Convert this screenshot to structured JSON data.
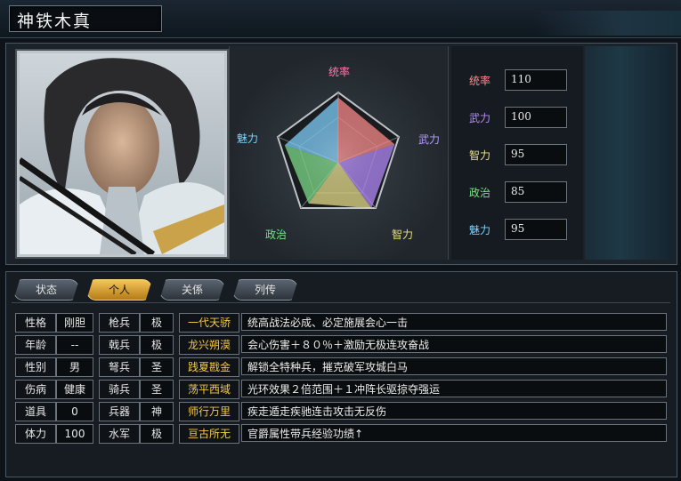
{
  "header": {
    "name": "神铁木真"
  },
  "radar": {
    "labels": {
      "top": "统率",
      "right": "武力",
      "bottom_right": "智力",
      "bottom_left": "政治",
      "left": "魅力"
    },
    "values": [
      110,
      100,
      95,
      85,
      95
    ]
  },
  "stats": [
    {
      "label": "统率",
      "value": "110",
      "color": "#ff8a8a"
    },
    {
      "label": "武力",
      "value": "100",
      "color": "#b58aff"
    },
    {
      "label": "智力",
      "value": "95",
      "color": "#e9e08a"
    },
    {
      "label": "政治",
      "value": "85",
      "color": "#7ee08a"
    },
    {
      "label": "魅力",
      "value": "95",
      "color": "#7fd2ff"
    }
  ],
  "tabs": [
    "状态",
    "个人",
    "关係",
    "列传"
  ],
  "active_tab": "个人",
  "attributes": [
    {
      "label": "性格",
      "value": "刚胆",
      "unit": "枪兵",
      "rank": "极"
    },
    {
      "label": "年龄",
      "value": "--",
      "unit": "戟兵",
      "rank": "极"
    },
    {
      "label": "性别",
      "value": "男",
      "unit": "弩兵",
      "rank": "圣"
    },
    {
      "label": "伤病",
      "value": "健康",
      "unit": "骑兵",
      "rank": "圣"
    },
    {
      "label": "道具",
      "value": "0",
      "unit": "兵器",
      "rank": "神"
    },
    {
      "label": "体力",
      "value": "100",
      "unit": "水军",
      "rank": "极"
    }
  ],
  "skills": [
    {
      "name": "一代天骄",
      "desc": "统高战法必成、必定施展会心一击"
    },
    {
      "name": "龙兴朔漠",
      "desc": "会心伤害＋８０％＋激励无极连攻奋战"
    },
    {
      "name": "践夏戡金",
      "desc": "解锁全特种兵，摧克破军攻城白马"
    },
    {
      "name": "荡平西域",
      "desc": "光环效果２倍范围＋１冲阵长驱掠夺强运"
    },
    {
      "name": "师行万里",
      "desc": "疾走遁走疾驰连击攻击无反伤"
    },
    {
      "name": "亘古所无",
      "desc": "官爵属性带兵经验功绩↑"
    }
  ]
}
